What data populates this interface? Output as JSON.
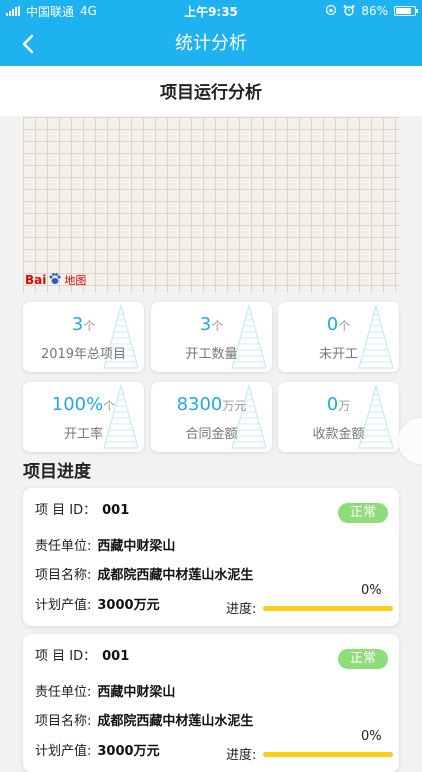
{
  "status_bar": {
    "carrier": "中国联通",
    "network": "4G",
    "time": "上午9:35",
    "battery": "86%",
    "battery_level": 0.86
  },
  "nav": {
    "back_icon": "chevron-left-icon",
    "title": "统计分析"
  },
  "section": {
    "title": "项目运行分析"
  },
  "map": {
    "logo_bai": "Bai",
    "logo_du": "du",
    "logo_ditu": "地图"
  },
  "stats": [
    {
      "value": "3",
      "unit": "个",
      "label": "2019年总项目"
    },
    {
      "value": "3",
      "unit": "个",
      "label": "开工数量"
    },
    {
      "value": "0",
      "unit": "个",
      "label": "未开工"
    },
    {
      "value": "100%",
      "unit": "个",
      "label": "开工率"
    },
    {
      "value": "8300",
      "unit": "万元",
      "label": "合同金额"
    },
    {
      "value": "0",
      "unit": "万",
      "label": "收款金额"
    }
  ],
  "progress_section": {
    "title": "项目进度"
  },
  "projects": [
    {
      "id_label": "项 目 ID：",
      "id": "001",
      "status": "正常",
      "unit_label": "责任单位:",
      "unit": "西藏中财梁山",
      "name_label": "项目名称:",
      "name": "成都院西藏中材莲山水泥生",
      "output_label": "计划产值:",
      "output": "3000万元",
      "progress_label": "进度:",
      "progress_text": "0%",
      "progress": 0
    },
    {
      "id_label": "项 目 ID：",
      "id": "001",
      "status": "正常",
      "unit_label": "责任单位:",
      "unit": "西藏中财梁山",
      "name_label": "项目名称:",
      "name": "成都院西藏中材莲山水泥生",
      "output_label": "计划产值:",
      "output": "3000万元",
      "progress_label": "进度:",
      "progress_text": "0%",
      "progress": 0
    }
  ],
  "colors": {
    "primary": "#1fb2f0",
    "accent_value": "#25a6e6",
    "badge": "#8fdc7a",
    "progress_track": "#ffcd19"
  }
}
